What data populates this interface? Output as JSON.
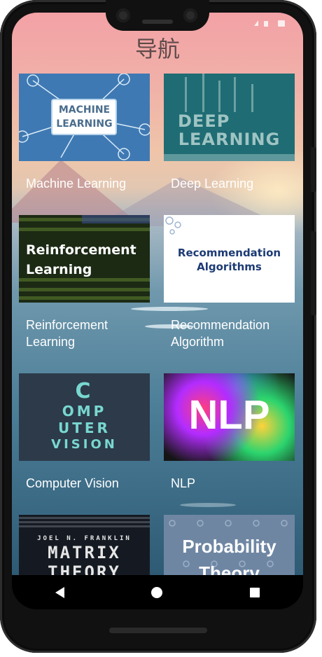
{
  "header": {
    "title": "导航"
  },
  "cards": [
    {
      "thumb_text": "MACHINE LEARNING",
      "thumb_lines": [
        "MACHINE",
        "LEARNING"
      ],
      "label": "Machine Learning"
    },
    {
      "thumb_text": "DEEP LEARNING",
      "thumb_lines": [
        "DEEP",
        "LEARNING"
      ],
      "label": "Deep Learning"
    },
    {
      "thumb_text": "Reinforcement Learning",
      "thumb_lines": [
        "Reinforcement",
        "Learning"
      ],
      "label": "Reinforcement Learning"
    },
    {
      "thumb_text": "Recommendation Algorithms",
      "thumb_lines": [
        "Recommendation",
        "Algorithms"
      ],
      "label": "Recommendation Algorithm"
    },
    {
      "thumb_text": "COMPUTER VISION",
      "thumb_lines": [
        "C",
        "OMP",
        "UTER",
        "VISION"
      ],
      "label": "Computer Vision"
    },
    {
      "thumb_text": "NLP",
      "thumb_lines": [
        "NLP"
      ],
      "label": "NLP"
    },
    {
      "thumb_text": "JOEL N. FRANKLIN MATRIX THEORY",
      "thumb_lines": [
        "JOEL N. FRANKLIN",
        "MATRIX",
        "THEORY"
      ],
      "label": ""
    },
    {
      "thumb_text": "Probability Theory",
      "thumb_lines": [
        "Probability",
        "Theory"
      ],
      "label": ""
    }
  ],
  "nav": {
    "back_icon": "back-triangle-icon",
    "home_icon": "home-circle-icon",
    "recent_icon": "recent-square-icon"
  },
  "colors": {
    "text": "#ffffff",
    "header": "#5e4a4a"
  }
}
